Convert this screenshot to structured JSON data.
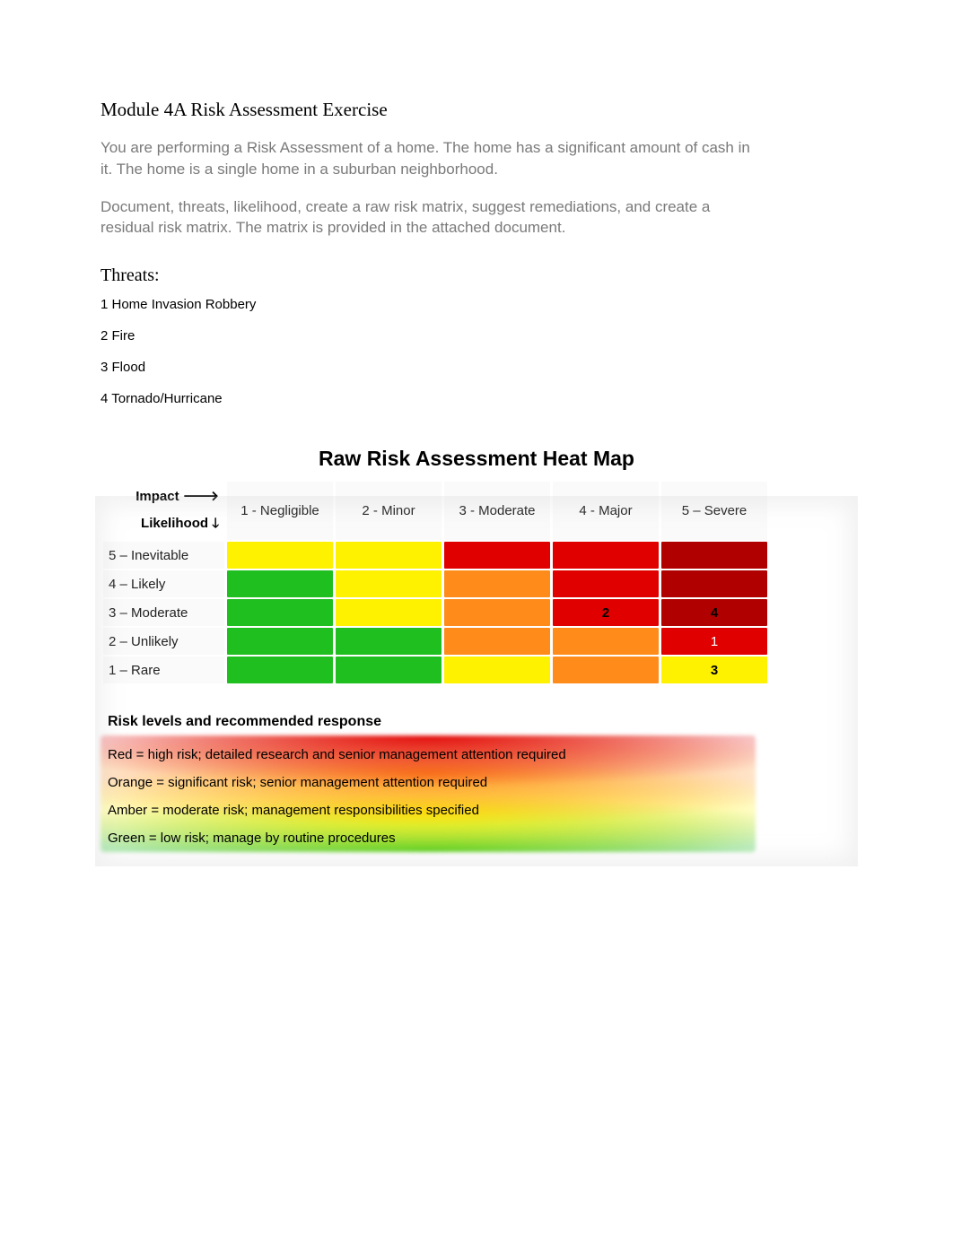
{
  "title": "Module 4A Risk Assessment Exercise",
  "intro1": "You are performing a Risk Assessment of a home. The home has a significant amount of cash in it. The home is a single home in a suburban neighborhood.",
  "intro2": "Document, threats, likelihood, create a raw risk matrix, suggest remediations, and create a residual risk matrix. The matrix is provided in the attached document.",
  "threats_heading": "Threats:",
  "threats": [
    "1 Home Invasion Robbery",
    "2 Fire",
    "3 Flood",
    "4 Tornado/Hurricane"
  ],
  "heatmap": {
    "title": "Raw Risk Assessment Heat Map",
    "axis_impact": "Impact 🡒",
    "axis_likelihood": "Likelihood 🡓",
    "impact_labels": [
      "1 - Negligible",
      "2 - Minor",
      "3 - Moderate",
      "4 - Major",
      "5 – Severe"
    ],
    "likelihood_labels": [
      "5 – Inevitable",
      "4 – Likely",
      "3 – Moderate",
      "2 – Unlikely",
      "1 – Rare"
    ]
  },
  "chart_data": {
    "type": "heatmap",
    "title": "Raw Risk Assessment Heat Map",
    "xlabel": "Impact",
    "ylabel": "Likelihood",
    "x_categories": [
      "1 - Negligible",
      "2 - Minor",
      "3 - Moderate",
      "4 - Major",
      "5 – Severe"
    ],
    "y_categories": [
      "5 – Inevitable",
      "4 – Likely",
      "3 – Moderate",
      "2 – Unlikely",
      "1 – Rare"
    ],
    "color_levels": {
      "green": "low risk",
      "yellow": "moderate risk",
      "orange": "significant risk",
      "red": "high risk",
      "darkred": "high risk"
    },
    "grid_colors": [
      [
        "yellow",
        "yellow",
        "red",
        "red",
        "darkred"
      ],
      [
        "green",
        "yellow",
        "orange",
        "red",
        "darkred"
      ],
      [
        "green",
        "yellow",
        "orange",
        "red",
        "darkred"
      ],
      [
        "green",
        "green",
        "orange",
        "orange",
        "red"
      ],
      [
        "green",
        "green",
        "yellow",
        "orange",
        "yellow"
      ]
    ],
    "cell_annotations": [
      [
        "",
        "",
        "",
        "",
        ""
      ],
      [
        "",
        "",
        "",
        "",
        ""
      ],
      [
        "",
        "",
        "",
        "2",
        "4"
      ],
      [
        "",
        "",
        "",
        "",
        "1"
      ],
      [
        "",
        "",
        "",
        "",
        "3"
      ]
    ],
    "annotation_meaning": "numbers correspond to threat list indices",
    "threat_numbers": {
      "1": "Home Invasion Robbery",
      "2": "Fire",
      "3": "Flood",
      "4": "Tornado/Hurricane"
    }
  },
  "legend": {
    "title": "Risk levels and recommended response",
    "lines": [
      "Red = high risk; detailed research and senior management attention required",
      "Orange  = significant risk; senior management attention required",
      "Amber = moderate risk; management responsibilities specified",
      "Green = low risk; manage by routine procedures"
    ]
  }
}
